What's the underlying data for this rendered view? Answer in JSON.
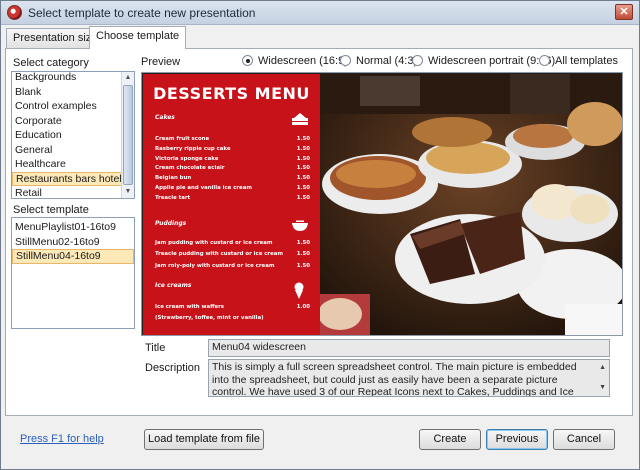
{
  "window": {
    "title": "Select template to create new presentation"
  },
  "tabs": [
    {
      "label": "Presentation size",
      "active": false
    },
    {
      "label": "Choose template",
      "active": true
    }
  ],
  "category": {
    "label": "Select category",
    "items": [
      "Backgrounds",
      "Blank",
      "Control examples",
      "Corporate",
      "Education",
      "General",
      "Healthcare",
      "Restaurants bars hotels",
      "Retail"
    ],
    "selected": "Restaurants bars hotels"
  },
  "template": {
    "label": "Select template",
    "items": [
      "MenuPlaylist01-16to9",
      "StillMenu02-16to9",
      "StillMenu04-16to9"
    ],
    "selected": "StillMenu04-16to9"
  },
  "preview": {
    "label": "Preview",
    "options": [
      {
        "label": "Widescreen (16:9)",
        "checked": true
      },
      {
        "label": "Normal (4:3)",
        "checked": false
      },
      {
        "label": "Widescreen portrait (9:16)",
        "checked": false
      },
      {
        "label": "All templates",
        "checked": false
      }
    ],
    "menu": {
      "title": "DESSERTS MENU",
      "sections": [
        {
          "name": "Cakes",
          "icon": "cake-icon",
          "items": [
            {
              "name": "Cream fruit scone",
              "price": "1.50"
            },
            {
              "name": "Rasberry ripple cup cake",
              "price": "1.50"
            },
            {
              "name": "Victoria sponge cake",
              "price": "1.50"
            },
            {
              "name": "Cream chocolate eclair",
              "price": "1.50"
            },
            {
              "name": "Belgian bun",
              "price": "1.50"
            },
            {
              "name": "Applie pie and vanilla ice cream",
              "price": "1.50"
            },
            {
              "name": "Treacle tart",
              "price": "1.50"
            }
          ]
        },
        {
          "name": "Puddings",
          "icon": "bowl-icon",
          "items": [
            {
              "name": "Jam pudding with custard or ice cream",
              "price": "1.50"
            },
            {
              "name": "Treacle pudding with custard or ice cream",
              "price": "1.50"
            },
            {
              "name": "Jam roly-poly with custard or ice cream",
              "price": "1.50"
            }
          ]
        },
        {
          "name": "Ice creams",
          "icon": "ice-cream-icon",
          "items": [
            {
              "name": "Ice cream with waffers",
              "price": "1.00"
            },
            {
              "name": "(Strawberry, toffee, mint or vanilla)",
              "price": ""
            }
          ]
        }
      ]
    }
  },
  "details": {
    "title_label": "Title",
    "title_value": "Menu04 widescreen",
    "description_label": "Description",
    "description_value": "This is simply a full screen spreadsheet control.  The main picture is embedded into the spreadsheet, but could just as easily have been a separate picture control.  We have used 3 of our Repeat Icons next to Cakes, Puddings and Ice creams, and set the colour to white on a red background to match"
  },
  "footer": {
    "help": "Press F1 for help",
    "load": "Load template from file",
    "create": "Create",
    "previous": "Previous",
    "cancel": "Cancel"
  },
  "colors": {
    "menu_red": "#c8121a",
    "selection": "#fde9b8",
    "link": "#2d60b8"
  }
}
